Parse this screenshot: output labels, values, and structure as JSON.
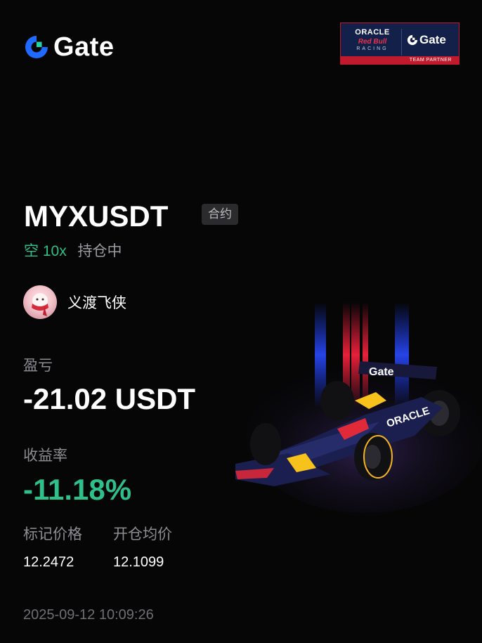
{
  "brand": {
    "name": "Gate",
    "logo_icon": "gate-logo-icon",
    "accent": "#1f6bff",
    "accent2": "#22d3a6"
  },
  "partner_badge": {
    "oracle": "ORACLE",
    "red_bull": "Red Bull",
    "racing": "RACING",
    "gate": "Gate",
    "team_partner": "TEAM PARTNER"
  },
  "position": {
    "symbol": "MYXUSDT",
    "type_tag": "合约",
    "side": "空",
    "leverage": "10x",
    "status": "持仓中"
  },
  "user": {
    "name": "义渡飞侠",
    "avatar": "avatar-image"
  },
  "pnl": {
    "label": "盈亏",
    "value": "-21.02 USDT"
  },
  "roi": {
    "label": "收益率",
    "value": "-11.18%",
    "color": "#2fbf8a"
  },
  "prices": {
    "mark_label": "标记价格",
    "mark_value": "12.2472",
    "entry_label": "开仓均价",
    "entry_value": "12.1099"
  },
  "timestamp": "2025-09-12 10:09:26",
  "illustration": {
    "car_livery": "Gate",
    "car_sponsor": "ORACLE"
  }
}
